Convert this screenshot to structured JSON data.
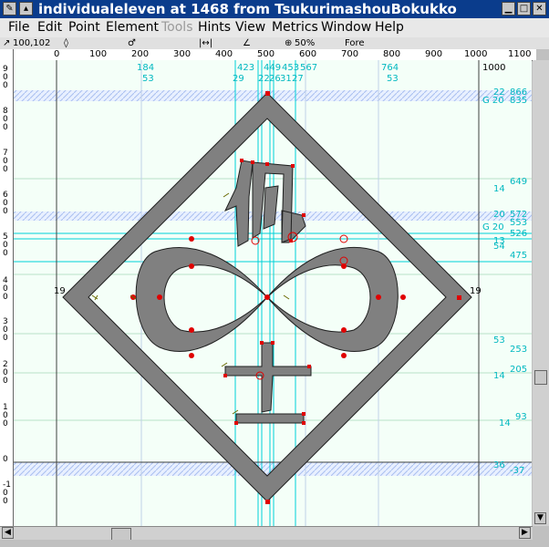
{
  "window": {
    "title": "individualeleven at 1468 from TsukurimashouBokukko",
    "minimize_glyph": "▁",
    "maximize_glyph": "□",
    "close_glyph": "✕"
  },
  "menu": [
    "File",
    "Edit",
    "Point",
    "Element",
    "Tools",
    "Hints",
    "View",
    "Metrics",
    "Window",
    "Help"
  ],
  "info": {
    "coords": "100,102",
    "zoom": "50%",
    "layer": "Fore"
  },
  "hruler": [
    "0",
    "100",
    "200",
    "300",
    "400",
    "500",
    "600",
    "700",
    "800",
    "900",
    "1000",
    "1100"
  ],
  "vruler": [
    "900",
    "800",
    "700",
    "600",
    "500",
    "400",
    "300",
    "200",
    "100",
    "0",
    "-100"
  ],
  "metrics_top": {
    "row1": [
      "184",
      "423",
      "449",
      "453",
      "567",
      "764",
      "1000"
    ],
    "row2": [
      "53",
      "29",
      "22",
      "26",
      "31",
      "27",
      "53"
    ]
  },
  "metrics_right": [
    {
      "a": "22",
      "b": "866"
    },
    {
      "a": "G 20",
      "b": "835"
    },
    {
      "a": "14",
      "b": "649"
    },
    {
      "a": "20",
      "b": "572"
    },
    {
      "a": "G 20",
      "b": "553"
    },
    {
      "a": "",
      "b": "526"
    },
    {
      "a": "13",
      "b": ""
    },
    {
      "a": "54",
      "b": "475"
    },
    {
      "a": "53",
      "b": "253"
    },
    {
      "a": "14",
      "b": "205"
    },
    {
      "a": "14",
      "b": "93"
    },
    {
      "a": "36",
      "b": "-37"
    }
  ],
  "side_labels": {
    "left": "19",
    "right": "19"
  },
  "colors": {
    "accent": "#0a3c8c",
    "hint": "#00c8d0",
    "glyph_fill": "#808080",
    "point": "#e00000"
  }
}
